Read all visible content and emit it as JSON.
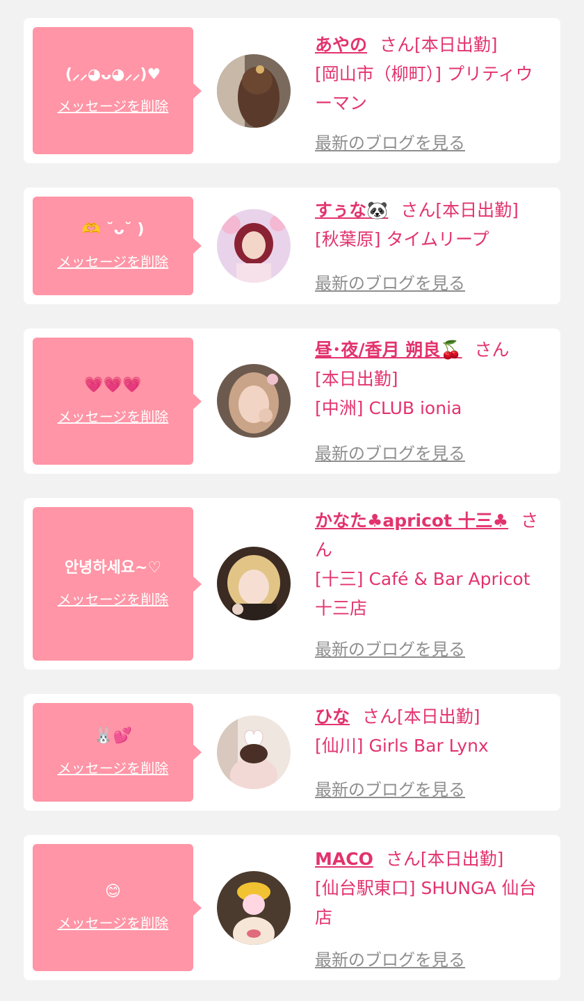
{
  "common": {
    "delete_label": "メッセージを削除",
    "blog_label": "最新のブログを見る",
    "san_label": "さん"
  },
  "colors": {
    "page_bg": "#f2f2f2",
    "card_bg": "#ffffff",
    "bubble_bg": "#ff95a6",
    "accent": "#e2336d",
    "muted": "#8e8e8e"
  },
  "entries": [
    {
      "message": "(⸝⸝◕ᴗ◕⸝⸝)♥",
      "name": "あやの",
      "status": "[本日出勤]",
      "shop": "[岡山市（柳町）] プリティウーマン",
      "avatar_icon": "profile-photo-avatar"
    },
    {
      "message": "🫶 ˘ᴗ˘ )",
      "name": "すぅな🐼",
      "status": "[本日出勤]",
      "shop": "[秋葉原] タイムリープ",
      "avatar_icon": "profile-photo-avatar"
    },
    {
      "message": "💗💗💗",
      "name": "昼･夜/香月 朔良🍒",
      "status": "[本日出勤]",
      "shop": "[中洲] CLUB ionia",
      "avatar_icon": "profile-photo-avatar"
    },
    {
      "message": "안녕하세요~♡",
      "name": "かなた♣apricot 十三♣",
      "status": "",
      "shop": "[十三] Café & Bar Apricot 十三店",
      "avatar_icon": "profile-photo-avatar"
    },
    {
      "message": "🐰💕",
      "name": "ひな",
      "status": "[本日出勤]",
      "shop": "[仙川] Girls Bar Lynx",
      "avatar_icon": "profile-photo-avatar"
    },
    {
      "message": "😊",
      "name": "MACO",
      "status": "[本日出勤]",
      "shop": "[仙台駅東口] SHUNGA 仙台店",
      "avatar_icon": "profile-photo-avatar"
    }
  ]
}
